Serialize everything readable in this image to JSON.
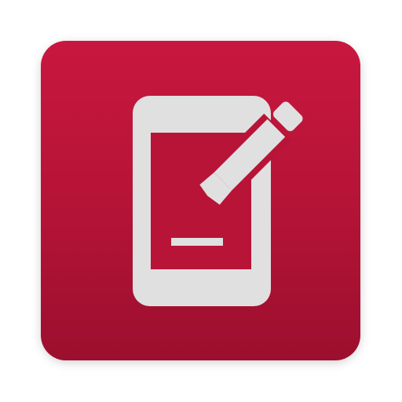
{
  "app": {
    "name": "",
    "icon": "phone-with-pencil-icon",
    "colors": {
      "background_top": "#c8173f",
      "background_bottom": "#9c0f2e",
      "glyph": "#e0e0e0",
      "screen": "#b81438"
    }
  }
}
